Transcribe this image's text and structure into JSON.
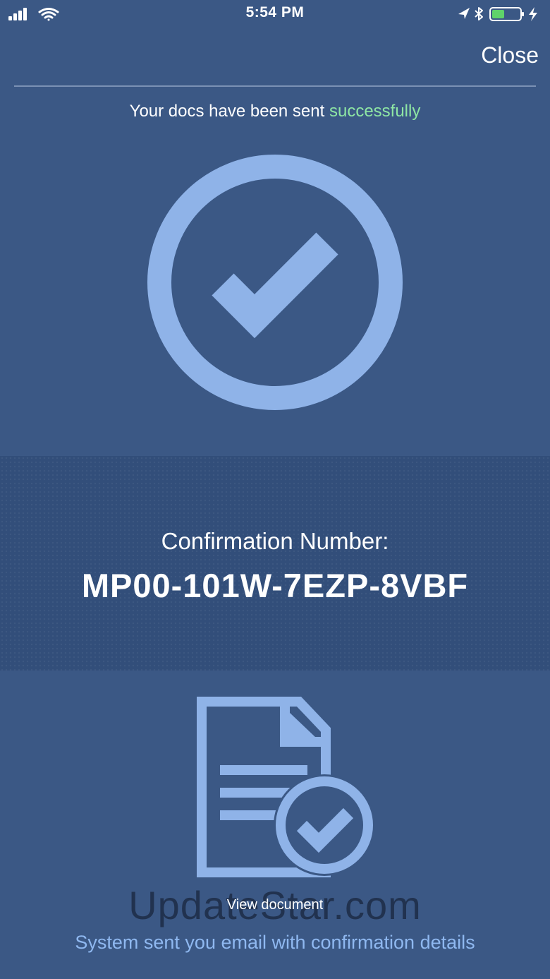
{
  "status_bar": {
    "time": "5:54 PM",
    "icons": [
      "cellular-signal-icon",
      "wifi-icon",
      "location-arrow-icon",
      "bluetooth-icon",
      "battery-charging-icon"
    ]
  },
  "header": {
    "close_label": "Close"
  },
  "message": {
    "prefix": "Your docs have been sent ",
    "highlight": "successfully"
  },
  "confirmation": {
    "label": "Confirmation Number:",
    "number": "MP00-101W-7EZP-8VBF"
  },
  "document": {
    "view_label": "View document"
  },
  "footer": {
    "email_note": "System sent you email with confirmation details"
  },
  "watermark": {
    "text": "UpdateStar.com"
  },
  "colors": {
    "background": "#3b5885",
    "band": "#324e7a",
    "accent_icon": "#8fb3e8",
    "success_text": "#8ee6a4",
    "note_text": "#8fb8f0"
  }
}
